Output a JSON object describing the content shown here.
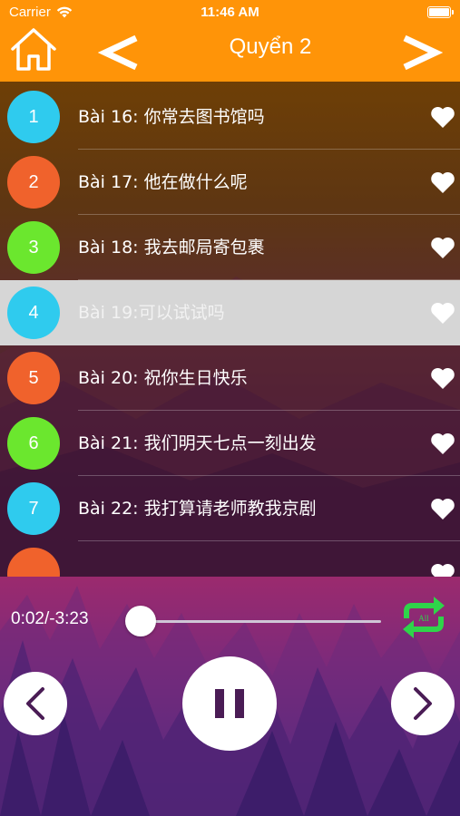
{
  "status_bar": {
    "carrier": "Carrier",
    "time": "11:46 AM"
  },
  "navbar": {
    "title": "Quyển 2",
    "background": "#ff9408",
    "home_icon": "home-icon",
    "prev_icon": "chevron-left-icon",
    "next_icon": "chevron-right-icon"
  },
  "lessons": [
    {
      "number": "1",
      "title": "Bài 16: 你常去图书馆吗",
      "color": "#2fcbee",
      "selected": false
    },
    {
      "number": "2",
      "title": "Bài 17: 他在做什么呢",
      "color": "#f0622c",
      "selected": false
    },
    {
      "number": "3",
      "title": "Bài 18: 我去邮局寄包裹",
      "color": "#6be72e",
      "selected": false
    },
    {
      "number": "4",
      "title": "Bài 19:可以试试吗",
      "color": "#2fcbee",
      "selected": true
    },
    {
      "number": "5",
      "title": "Bài 20: 祝你生日快乐",
      "color": "#f0622c",
      "selected": false
    },
    {
      "number": "6",
      "title": "Bài 21: 我们明天七点一刻出发",
      "color": "#6be72e",
      "selected": false
    },
    {
      "number": "7",
      "title": "Bài 22: 我打算请老师教我京剧",
      "color": "#2fcbee",
      "selected": false
    },
    {
      "number": "",
      "title": "",
      "color": "#f0622c",
      "selected": false
    }
  ],
  "player": {
    "time": "0:02/-3:23",
    "progress": 0.01,
    "repeat_label": "All",
    "repeat_color": "#2fd44a",
    "prev_icon": "chevron-left-icon",
    "pause_icon": "pause-icon",
    "next_icon": "chevron-right-icon",
    "button_icon_color": "#4a1c55"
  }
}
